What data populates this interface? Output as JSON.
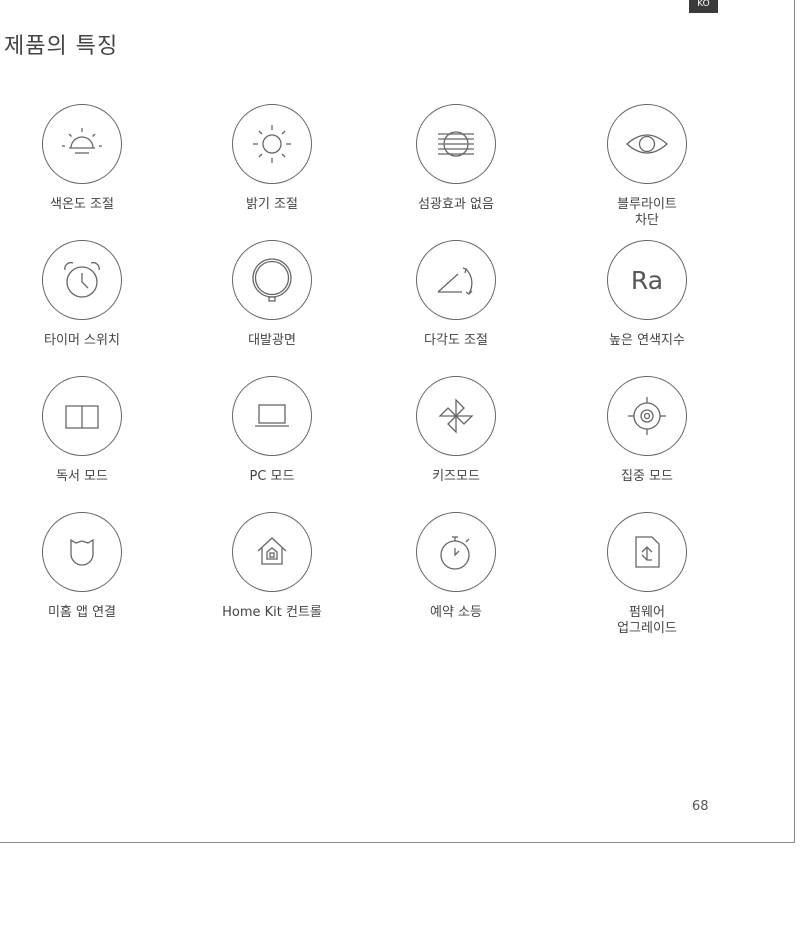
{
  "header": {
    "badge": "KO",
    "title": "제품의 특징"
  },
  "features": [
    {
      "label": "색온도 조절",
      "icon": "sunrise-icon"
    },
    {
      "label": "밝기 조절",
      "icon": "sun-icon"
    },
    {
      "label": "섬광효과 없음",
      "icon": "lines-circle-icon"
    },
    {
      "label": "블루라이트\n차단",
      "icon": "eye-icon"
    },
    {
      "label": "타이머 스위치",
      "icon": "alarm-clock-icon"
    },
    {
      "label": "대발광면",
      "icon": "lamp-head-icon"
    },
    {
      "label": "다각도 조절",
      "icon": "angle-rotate-icon"
    },
    {
      "label": "높은 연색지수",
      "icon": "ra-text-icon",
      "icon_text": "Ra"
    },
    {
      "label": "독서 모드",
      "icon": "open-book-icon"
    },
    {
      "label": "PC 모드",
      "icon": "laptop-icon"
    },
    {
      "label": "키즈모드",
      "icon": "pinwheel-icon"
    },
    {
      "label": "집중 모드",
      "icon": "target-icon"
    },
    {
      "label": "미홈 앱 연결",
      "icon": "mi-home-icon"
    },
    {
      "label": "Home Kit 컨트롤",
      "icon": "homekit-icon"
    },
    {
      "label": "예약 소등",
      "icon": "stopwatch-icon"
    },
    {
      "label": "펌웨어\n업그레이드",
      "icon": "firmware-upgrade-icon"
    }
  ],
  "footer": {
    "page_number": "68"
  }
}
